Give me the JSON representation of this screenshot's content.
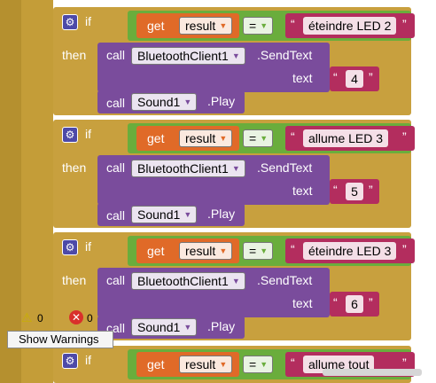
{
  "keywords": {
    "if": "if",
    "then": "then",
    "call": "call",
    "get": "get",
    "text": "text"
  },
  "dropdowns": {
    "variable": "result",
    "operator": "=",
    "component_bt": "BluetoothClient1",
    "component_sound": "Sound1"
  },
  "methods": {
    "send": ".SendText",
    "play": ".Play"
  },
  "quote_open": "“",
  "quote_close": "”",
  "blocks": [
    {
      "compare": "éteindre LED 2",
      "send_value": "4"
    },
    {
      "compare": "allume LED 3",
      "send_value": "5"
    },
    {
      "compare": "éteindre LED 3",
      "send_value": "6"
    },
    {
      "compare": "allume tout"
    }
  ],
  "status": {
    "warnings": "0",
    "errors": "0",
    "show_warnings_label": "Show Warnings"
  },
  "colors": {
    "control": "#c8a03e",
    "logic": "#6aad3c",
    "variable": "#e06a28",
    "text": "#b32d5e",
    "component": "#7a4c9c"
  },
  "icons": [
    "gear-icon",
    "warning-icon",
    "error-icon"
  ]
}
